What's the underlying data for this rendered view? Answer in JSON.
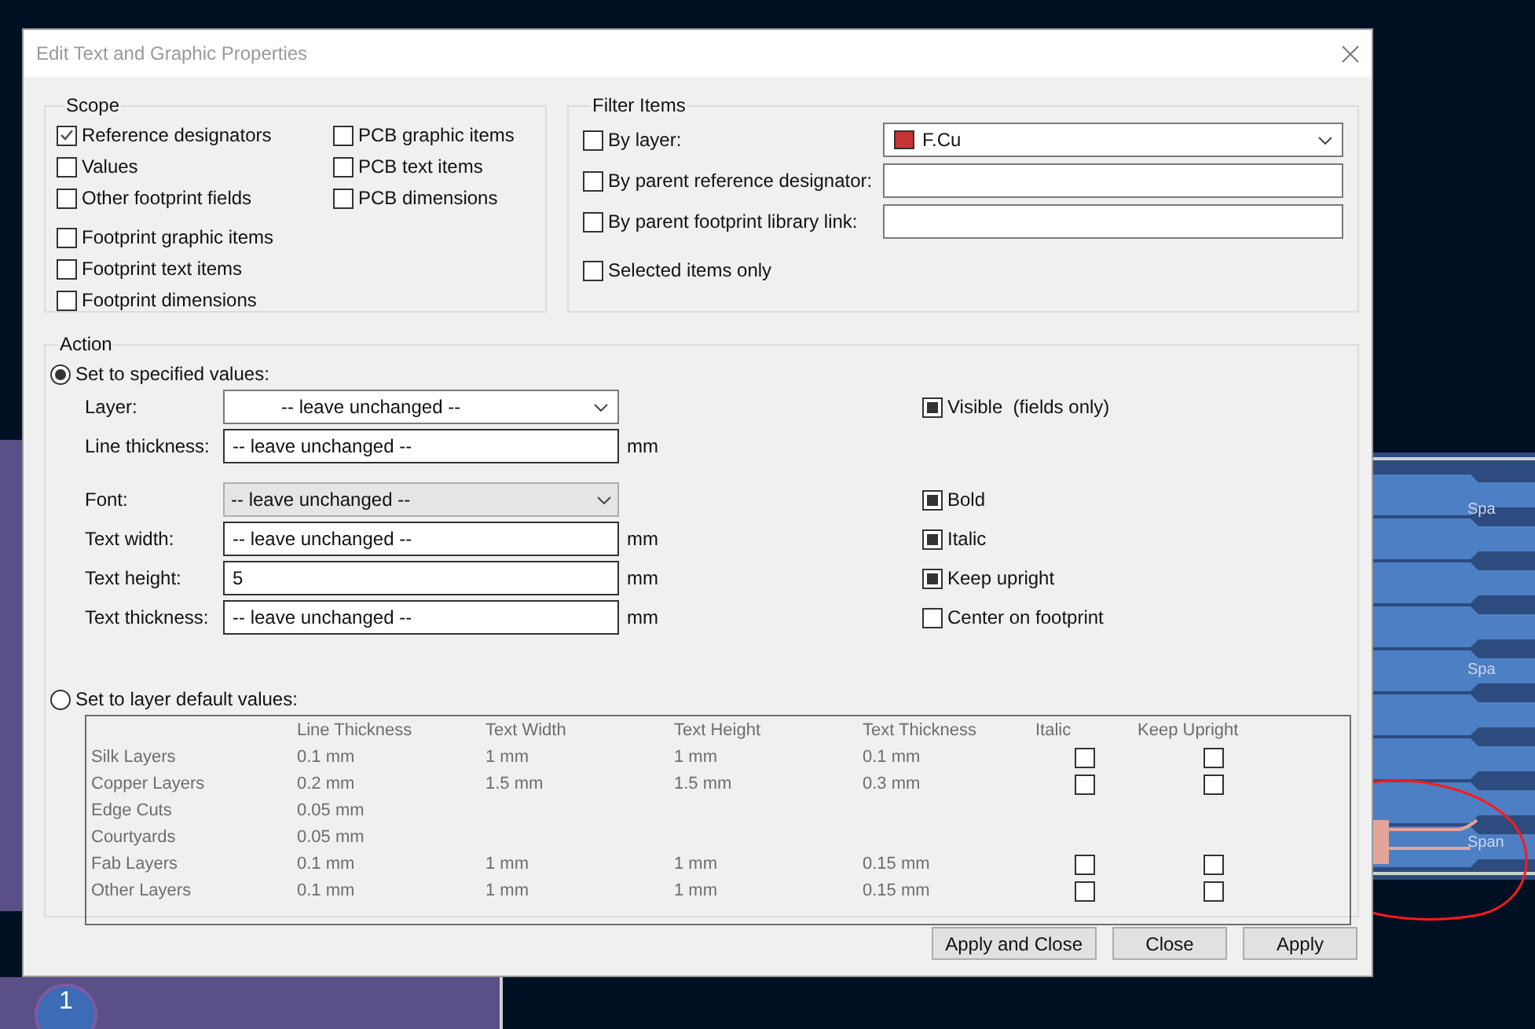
{
  "dialog": {
    "title": "Edit Text and Graphic Properties"
  },
  "scope": {
    "title": "Scope",
    "left_groups": [
      [
        {
          "label": "Reference designators",
          "checked": true
        },
        {
          "label": "Values",
          "checked": false
        },
        {
          "label": "Other footprint fields",
          "checked": false
        }
      ],
      [
        {
          "label": "Footprint graphic items",
          "checked": false
        },
        {
          "label": "Footprint text items",
          "checked": false
        },
        {
          "label": "Footprint dimensions",
          "checked": false
        }
      ]
    ],
    "right": [
      {
        "label": "PCB graphic items",
        "checked": false
      },
      {
        "label": "PCB text items",
        "checked": false
      },
      {
        "label": "PCB dimensions",
        "checked": false
      }
    ]
  },
  "filter": {
    "title": "Filter Items",
    "rows": [
      {
        "kind": "dropdown",
        "label": "By layer:",
        "checked": false,
        "value": "F.Cu",
        "color": "#c83434"
      },
      {
        "kind": "input",
        "label": "By parent reference designator:",
        "checked": false
      },
      {
        "kind": "input",
        "label": "By parent footprint library link:",
        "checked": false
      },
      {
        "kind": "plain",
        "label": "Selected items only",
        "checked": false
      }
    ]
  },
  "action": {
    "title": "Action",
    "specified": {
      "label": "Set to specified values:",
      "selected": true
    },
    "field_groups": [
      [
        {
          "label": "Layer:",
          "kind": "combo",
          "value": "-- leave unchanged --",
          "option": {
            "label": "Visible  (fields only)",
            "checked": true
          }
        },
        {
          "label": "Line thickness:",
          "kind": "input",
          "value": "-- leave unchanged --",
          "unit": "mm"
        }
      ],
      [
        {
          "label": "Font:",
          "kind": "choice",
          "value": "-- leave unchanged --",
          "option": {
            "label": "Bold",
            "checked": true
          }
        },
        {
          "label": "Text width:",
          "kind": "input",
          "value": "-- leave unchanged --",
          "unit": "mm",
          "option": {
            "label": "Italic",
            "checked": true
          }
        },
        {
          "label": "Text height:",
          "kind": "input",
          "value": "5",
          "unit": "mm",
          "option": {
            "label": "Keep upright",
            "checked": true
          }
        },
        {
          "label": "Text thickness:",
          "kind": "input",
          "value": "-- leave unchanged --",
          "unit": "mm",
          "option": {
            "label": "Center on footprint",
            "checked": false
          }
        }
      ]
    ],
    "layer_defaults": {
      "label": "Set to layer default values:",
      "selected": false
    },
    "table": {
      "columns": [
        "Line Thickness",
        "Text Width",
        "Text Height",
        "Text Thickness",
        "Italic",
        "Keep Upright"
      ],
      "rows": [
        {
          "name": "Silk Layers",
          "line_thickness": "0.1 mm",
          "text_width": "1 mm",
          "text_height": "1 mm",
          "text_thickness": "0.1 mm",
          "italic": false,
          "keep_upright": false
        },
        {
          "name": "Copper Layers",
          "line_thickness": "0.2 mm",
          "text_width": "1.5 mm",
          "text_height": "1.5 mm",
          "text_thickness": "0.3 mm",
          "italic": false,
          "keep_upright": false
        },
        {
          "name": "Edge Cuts",
          "line_thickness": "0.05 mm"
        },
        {
          "name": "Courtyards",
          "line_thickness": "0.05 mm"
        },
        {
          "name": "Fab Layers",
          "line_thickness": "0.1 mm",
          "text_width": "1 mm",
          "text_height": "1 mm",
          "text_thickness": "0.15 mm",
          "italic": false,
          "keep_upright": false
        },
        {
          "name": "Other Layers",
          "line_thickness": "0.1 mm",
          "text_width": "1 mm",
          "text_height": "1 mm",
          "text_thickness": "0.15 mm",
          "italic": false,
          "keep_upright": false
        }
      ]
    }
  },
  "buttons": [
    "Apply and Close",
    "Close",
    "Apply"
  ],
  "pcb": {
    "pad_number": "1",
    "labels": [
      "Spa",
      "Spa",
      "Span"
    ]
  }
}
